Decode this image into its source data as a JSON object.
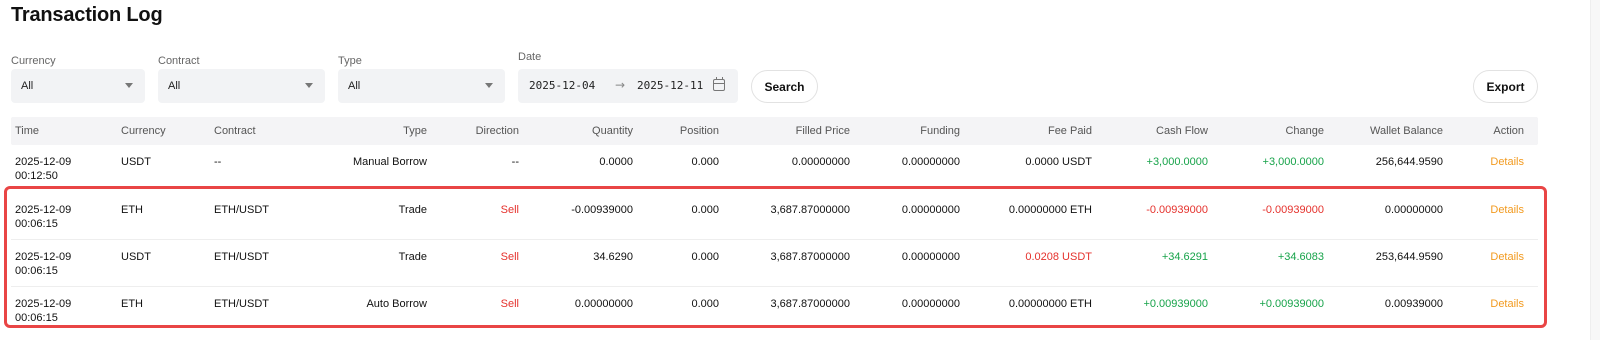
{
  "page": {
    "title": "Transaction Log"
  },
  "filters": {
    "currency": {
      "label": "Currency",
      "value": "All"
    },
    "contract": {
      "label": "Contract",
      "value": "All"
    },
    "type": {
      "label": "Type",
      "value": "All"
    },
    "date": {
      "label": "Date",
      "start": "2025-12-04",
      "separator": "→",
      "end": "2025-12-11"
    },
    "search_label": "Search",
    "export_label": "Export"
  },
  "table": {
    "columns": [
      "Time",
      "Currency",
      "Contract",
      "Type",
      "Direction",
      "Quantity",
      "Position",
      "Filled Price",
      "Funding",
      "Fee Paid",
      "Cash Flow",
      "Change",
      "Wallet Balance",
      "Action"
    ],
    "rows": [
      {
        "time_date": "2025-12-09",
        "time_clock": "00:12:50",
        "currency": "USDT",
        "contract": "--",
        "type": "Manual Borrow",
        "direction": "--",
        "quantity": "0.0000",
        "position": "0.000",
        "filled_price": "0.00000000",
        "funding": "0.00000000",
        "fee_paid": "0.0000 USDT",
        "cash_flow": "+3,000.0000",
        "change": "+3,000.0000",
        "wallet_balance": "256,644.9590",
        "action": "Details"
      },
      {
        "time_date": "2025-12-09",
        "time_clock": "00:06:15",
        "currency": "ETH",
        "contract": "ETH/USDT",
        "type": "Trade",
        "direction": "Sell",
        "quantity": "-0.00939000",
        "position": "0.000",
        "filled_price": "3,687.87000000",
        "funding": "0.00000000",
        "fee_paid": "0.00000000 ETH",
        "cash_flow": "-0.00939000",
        "change": "-0.00939000",
        "wallet_balance": "0.00000000",
        "action": "Details"
      },
      {
        "time_date": "2025-12-09",
        "time_clock": "00:06:15",
        "currency": "USDT",
        "contract": "ETH/USDT",
        "type": "Trade",
        "direction": "Sell",
        "quantity": "34.6290",
        "position": "0.000",
        "filled_price": "3,687.87000000",
        "funding": "0.00000000",
        "fee_paid": "0.0208 USDT",
        "cash_flow": "+34.6291",
        "change": "+34.6083",
        "wallet_balance": "253,644.9590",
        "action": "Details"
      },
      {
        "time_date": "2025-12-09",
        "time_clock": "00:06:15",
        "currency": "ETH",
        "contract": "ETH/USDT",
        "type": "Auto Borrow",
        "direction": "Sell",
        "quantity": "0.00000000",
        "position": "0.000",
        "filled_price": "3,687.87000000",
        "funding": "0.00000000",
        "fee_paid": "0.00000000 ETH",
        "cash_flow": "+0.00939000",
        "change": "+0.00939000",
        "wallet_balance": "0.00939000",
        "action": "Details"
      }
    ]
  },
  "colors": {
    "positive": "#17a34a",
    "negative": "#e5322d",
    "action": "#f29a1f",
    "highlight_border": "#e94545"
  }
}
